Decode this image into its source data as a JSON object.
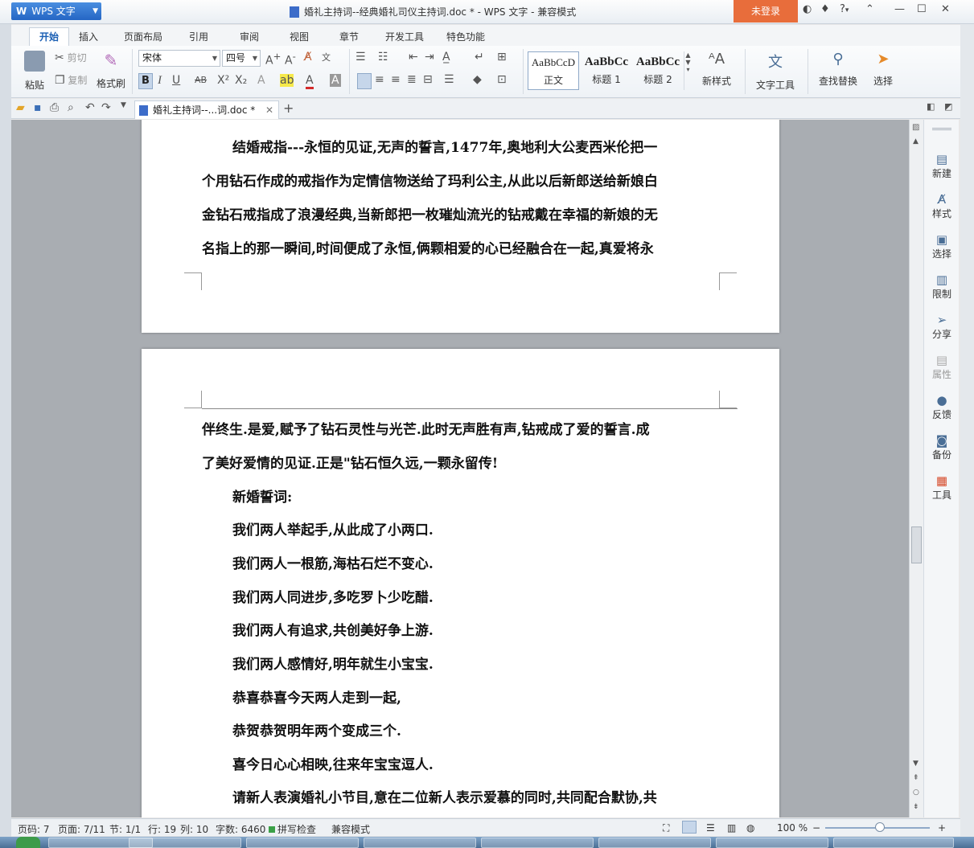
{
  "titlebar": {
    "app_name": "WPS 文字",
    "doc_title": "婚礼主持词--经典婚礼司仪主持词.doc * - WPS 文字 - 兼容模式",
    "login": "未登录",
    "help": "?"
  },
  "menu": {
    "tabs": [
      "开始",
      "插入",
      "页面布局",
      "引用",
      "审阅",
      "视图",
      "章节",
      "开发工具",
      "特色功能"
    ]
  },
  "ribbon": {
    "paste": "粘贴",
    "cut": "剪切",
    "copy": "复制",
    "format_painter": "格式刷",
    "font_name": "宋体",
    "font_size": "四号",
    "styles": [
      {
        "preview": "AaBbCcD",
        "name": "正文"
      },
      {
        "preview": "AaBbCc",
        "name": "标题 1"
      },
      {
        "preview": "AaBbCc",
        "name": "标题 2"
      }
    ],
    "new_style": "新样式",
    "text_tools": "文字工具",
    "find_replace": "查找替换",
    "select": "选择"
  },
  "doc_tab": {
    "label": "婚礼主持词--...词.doc *"
  },
  "document": {
    "page1_lines": [
      "结婚戒指---永恒的见证,无声的誓言,1477年,奥地利大公麦西米伦把一",
      "个用钻石作成的戒指作为定情信物送给了玛利公主,从此以后新郎送给新娘白",
      "金钻石戒指成了浪漫经典,当新郎把一枚璀灿流光的钻戒戴在幸福的新娘的无",
      "名指上的那一瞬间,时间便成了永恒,俩颗相爱的心已经融合在一起,真爱将永"
    ],
    "page2_lines": [
      "伴终生.是爱,赋予了钻石灵性与光芒.此时无声胜有声,钻戒成了爱的誓言.成",
      "了美好爱情的见证.正是\"钻石恒久远,一颗永留传!",
      "新婚誓词:",
      "我们两人举起手,从此成了小两口.",
      "我们两人一根筋,海枯石烂不变心.",
      "我们两人同进步,多吃罗卜少吃醋.",
      "我们两人有追求,共创美好争上游.",
      "我们两人感情好,明年就生小宝宝.",
      "恭喜恭喜今天两人走到一起,",
      "恭贺恭贺明年两个变成三个.",
      "喜今日心心相映,往来年宝宝逗人.",
      "请新人表演婚礼小节目,意在二位新人表示爱慕的同时,共同配合默协,共"
    ]
  },
  "side_panel": {
    "items": [
      "新建",
      "样式",
      "选择",
      "限制",
      "分享",
      "属性",
      "反馈",
      "备份",
      "工具"
    ]
  },
  "statusbar": {
    "page_code": "页码: 7",
    "page": "页面: 7/11",
    "section": "节: 1/1",
    "row": "行: 19",
    "col": "列: 10",
    "word_count": "字数: 6460",
    "spell_check": "拼写检查",
    "compat_mode": "兼容模式",
    "zoom": "100 %"
  },
  "colors": {
    "accent_blue": "#1a5fb4",
    "login_orange": "#e86d3b",
    "workspace_gray": "#a9adb2"
  }
}
